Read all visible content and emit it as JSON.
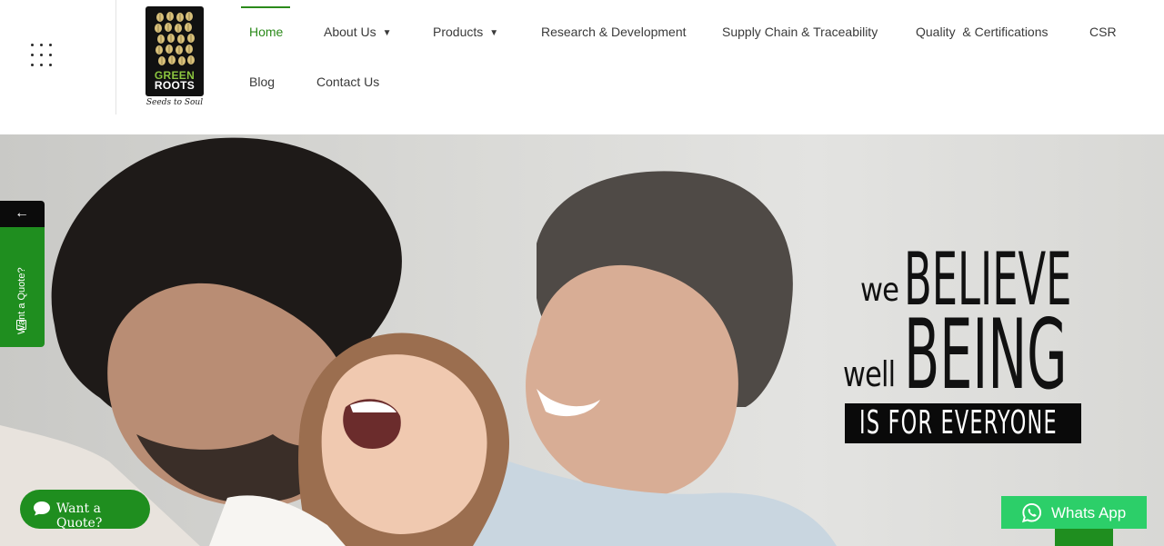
{
  "logo": {
    "line1": "GREEN",
    "line2": "ROOTS",
    "tagline": "Seeds to Soul"
  },
  "nav": {
    "items": [
      {
        "label": "Home",
        "active": true,
        "dropdown": false
      },
      {
        "label": "About Us",
        "active": false,
        "dropdown": true
      },
      {
        "label": "Products",
        "active": false,
        "dropdown": true
      },
      {
        "label": "Research & Development",
        "active": false,
        "dropdown": false
      },
      {
        "label": "Supply Chain & Traceability",
        "active": false,
        "dropdown": false
      },
      {
        "label": "Quality  & Certifications",
        "active": false,
        "dropdown": false
      },
      {
        "label": "CSR",
        "active": false,
        "dropdown": false
      },
      {
        "label": "Blog",
        "active": false,
        "dropdown": false
      },
      {
        "label": "Contact Us",
        "active": false,
        "dropdown": false
      }
    ]
  },
  "hero": {
    "slogan": {
      "we": "we",
      "believe": "BELIEVE",
      "well": "well",
      "being": "BEING",
      "everyone": "IS FOR EVERYONE"
    }
  },
  "side_tab": {
    "back_arrow": "←",
    "label": "Want a Quote?"
  },
  "float_quote": {
    "label": "Want a Quote?"
  },
  "whatsapp": {
    "label": "Whats App"
  },
  "colors": {
    "accent": "#1f8e1f",
    "whatsapp": "#2ccf69",
    "nav_active": "#2b8a1a"
  },
  "icons": [
    "grid-menu-icon",
    "chevron-down-icon",
    "chat-bubble-icon",
    "whatsapp-icon",
    "arrow-left-icon",
    "quote-form-icon"
  ]
}
